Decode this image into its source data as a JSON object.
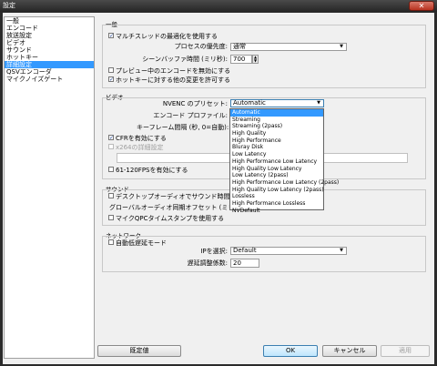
{
  "window": {
    "title": "設定",
    "close_glyph": "✕"
  },
  "sidebar": {
    "items": [
      {
        "label": "一般",
        "selected": false
      },
      {
        "label": "エンコード",
        "selected": false
      },
      {
        "label": "放送設定",
        "selected": false
      },
      {
        "label": "ビデオ",
        "selected": false
      },
      {
        "label": "サウンド",
        "selected": false
      },
      {
        "label": "ホットキー",
        "selected": false
      },
      {
        "label": "詳細設定",
        "selected": true
      },
      {
        "label": "QSVエンコーダ",
        "selected": false
      },
      {
        "label": "マイクノイズゲート",
        "selected": false
      }
    ]
  },
  "general": {
    "title": "一般",
    "multithread_label": "マルチスレッドの最適化を使用する",
    "multithread_checked": true,
    "priority_label": "プロセスの優先度:",
    "priority_value": "通常",
    "scene_buffer_label": "シーンバッファ時間 (ミリ秒):",
    "scene_buffer_value": "700",
    "disable_preview_encode_label": "プレビュー中のエンコードを無効にする",
    "disable_preview_encode_checked": false,
    "allow_hotkey_change_label": "ホットキーに対する他の変更を許可する",
    "allow_hotkey_change_checked": true
  },
  "video": {
    "title": "ビデオ",
    "nvenc_preset_label": "NVENC のプリセット:",
    "nvenc_preset_value": "Automatic",
    "encode_profile_label": "エンコード プロファイル:",
    "keyframe_label": "キーフレーム間隔 (秒, 0=自動):",
    "cfr_label": "CFRを有効にする",
    "cfr_checked": true,
    "x264_label": "x264の詳細設定",
    "x264_checked": false,
    "fps_label": "61-120FPSを有効にする",
    "fps_checked": false,
    "dropdown_options": [
      "Automatic",
      "Streaming",
      "Streaming (2pass)",
      "High Quality",
      "High Performance",
      "Bluray Disk",
      "Low Latency",
      "High Performance Low Latency",
      "High Quality Low Latency",
      "Low Latency (2pass)",
      "High Performance Low Latency (2pass)",
      "High Quality Low Latency (2pass)",
      "Lossless",
      "High Performance Lossless",
      "NVDefault"
    ],
    "dropdown_highlighted_index": 0
  },
  "sound": {
    "title": "サウンド",
    "desktop_sync_label": "デスクトップオーディオでサウンド時間の基準とし",
    "desktop_sync_checked": false,
    "global_offset_label": "グローバルオーディオ同期オフセット (ミリ秒):",
    "mic_qpc_label": "マイクQPCタイムスタンプを使用する",
    "mic_qpc_checked": false
  },
  "network": {
    "title": "ネットワーク",
    "auto_low_latency_label": "自動低遅延モード",
    "auto_low_latency_checked": false,
    "ip_label": "IPを選択:",
    "ip_value": "Default",
    "latency_label": "遅延調整係数:",
    "latency_value": "20"
  },
  "footer": {
    "defaults_button": "既定値",
    "ok_button": "OK",
    "cancel_button": "キャンセル",
    "apply_button": "適用"
  },
  "icons": {
    "checkmark": "✓",
    "dropdown_arrow": "▼",
    "spin_up": "▲",
    "spin_down": "▼"
  },
  "colors": {
    "selection": "#3399ff",
    "close_button": "#c0392b"
  }
}
